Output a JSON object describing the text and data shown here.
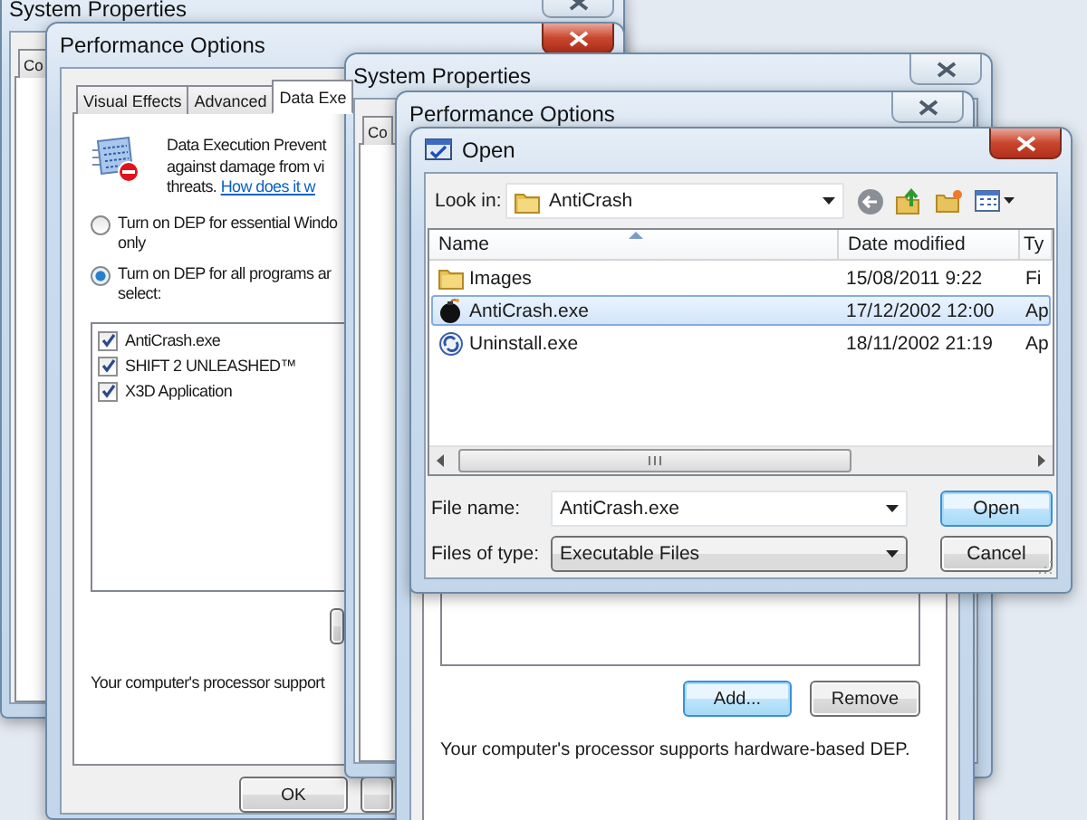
{
  "back_system_properties": {
    "title": "System Properties",
    "close_highlighted": false,
    "tabs": [
      {
        "label": "Co",
        "selected": false
      }
    ]
  },
  "performance_options": {
    "title": "Performance Options",
    "close_highlighted": true,
    "tabs": [
      {
        "label": "Visual Effects",
        "selected": false
      },
      {
        "label": "Advanced",
        "selected": false
      },
      {
        "label": "Data Exe",
        "selected": true
      }
    ],
    "description": [
      "Data Execution Prevent",
      "against damage from vi",
      "threats."
    ],
    "link": "How does it w",
    "options": [
      {
        "lines": [
          "Turn on DEP for essential Windo",
          "only"
        ],
        "selected": false
      },
      {
        "lines": [
          "Turn on DEP for all programs ar",
          "select:"
        ],
        "selected": true
      }
    ],
    "programs": [
      {
        "name": "AntiCrash.exe",
        "checked": true
      },
      {
        "name": "SHIFT 2 UNLEASHED™",
        "checked": true
      },
      {
        "name": "X3D Application",
        "checked": true
      }
    ],
    "status": "Your computer's processor support",
    "buttons": [
      {
        "label": "OK"
      }
    ]
  },
  "front_system_properties": {
    "title": "System Properties",
    "close_highlighted": false,
    "tabs": [
      {
        "label": "Co",
        "selected": false
      }
    ]
  },
  "front_performance_options": {
    "title": "Performance Options",
    "close_highlighted": false,
    "buttons": [
      {
        "label": "Add...",
        "default": true
      },
      {
        "label": "Remove",
        "default": false
      }
    ],
    "status": "Your computer's processor supports hardware-based DEP."
  },
  "open_dialog": {
    "title": "Open",
    "close_highlighted": true,
    "look_in": {
      "label": "Look in:",
      "value": "AntiCrash"
    },
    "columns": [
      "Name",
      "Date modified",
      "Ty"
    ],
    "files": [
      {
        "name": "Images",
        "kind": "folder",
        "date": "15/08/2011 9:22",
        "type": "Fi",
        "selected": false
      },
      {
        "name": "AntiCrash.exe",
        "kind": "bomb",
        "date": "17/12/2002 12:00",
        "type": "Ap",
        "selected": true
      },
      {
        "name": "Uninstall.exe",
        "kind": "installer",
        "date": "18/11/2002 21:19",
        "type": "Ap",
        "selected": false
      }
    ],
    "file_name": {
      "label": "File name:",
      "value": "AntiCrash.exe"
    },
    "file_type": {
      "label": "Files of type:",
      "value": "Executable Files"
    },
    "buttons": [
      {
        "label": "Open",
        "default": true
      },
      {
        "label": "Cancel",
        "default": false
      }
    ]
  }
}
